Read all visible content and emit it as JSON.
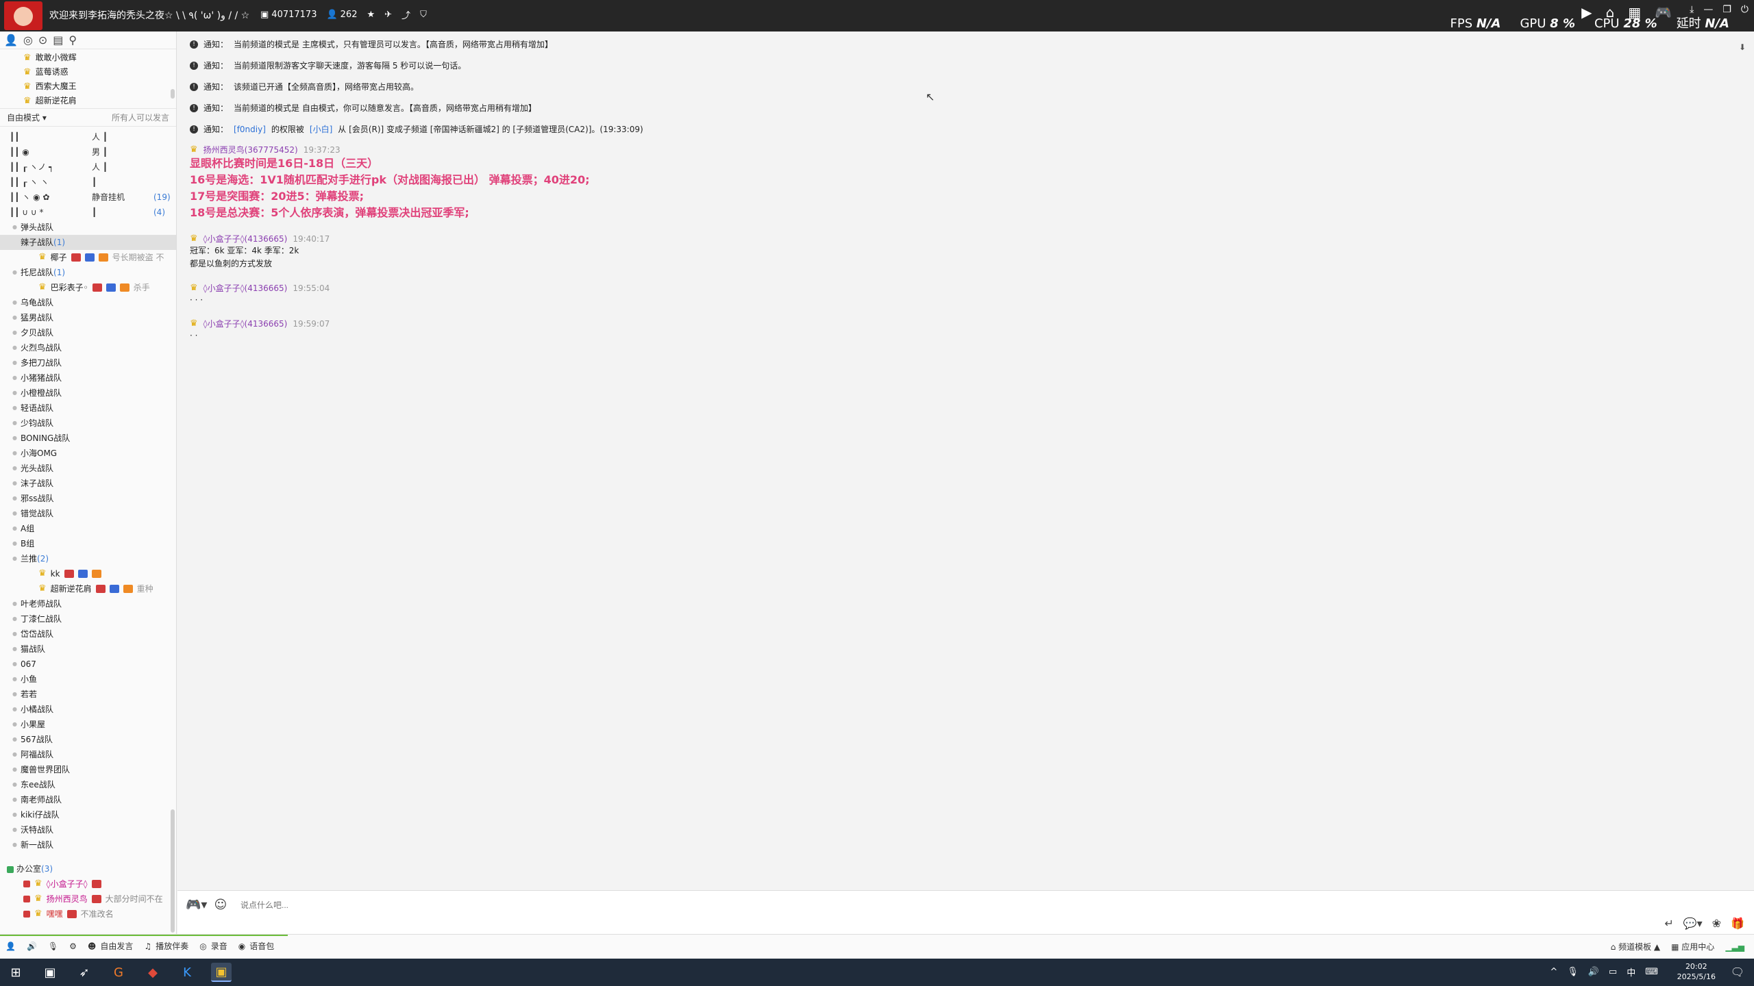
{
  "titlebar": {
    "title": "欢迎来到李拓海的秃头之夜☆ \\ \\ ٩( 'ω' )و / / ☆",
    "channel_id": "40717173",
    "online_count": "262",
    "fps_label": "FPS",
    "fps_value": "N/A",
    "gpu_label": "GPU",
    "gpu_value": "8 %",
    "cpu_label": "CPU",
    "cpu_value": "28 %",
    "latency_label": "延时",
    "latency_value": "N/A"
  },
  "sidebar": {
    "top_rows": [
      "敢敢小微辉",
      "蓝莓诱惑",
      "西索大魔王",
      "超新逆花肩"
    ],
    "mode_label": "自由模式",
    "mode_right": "所有人可以发言",
    "glyph_rows": [
      {
        "rune": "┃┃",
        "name": "人 ┃",
        "count": ""
      },
      {
        "rune": "┃┃    ◉",
        "name": "男 ┃",
        "count": ""
      },
      {
        "rune": "┃┃  ┎ ヽノ ┑",
        "name": "人 ┃",
        "count": ""
      },
      {
        "rune": "┃┃  ┎ ヽ   ヽ",
        "name": "┃",
        "count": ""
      },
      {
        "rune": "┃┃  ヽ  ◉  ✿",
        "name": "静音挂机",
        "count": "(19)"
      },
      {
        "rune": "┃┃  ∪ ∪   *",
        "name": "┃",
        "count": "(4)"
      }
    ],
    "channels": [
      {
        "name": "弹头战队",
        "count": ""
      },
      {
        "name": "辣子战队",
        "count": "(1)",
        "selected": true,
        "members": [
          {
            "name": "椰子",
            "status": "号长期被盗 不"
          }
        ]
      },
      {
        "name": "托尼战队",
        "count": "(1)",
        "members": [
          {
            "name": "巴彩表子◦",
            "status": "杀手"
          }
        ]
      },
      {
        "name": "乌龟战队",
        "count": ""
      },
      {
        "name": "猛男战队",
        "count": ""
      },
      {
        "name": "夕贝战队",
        "count": ""
      },
      {
        "name": "火烈鸟战队",
        "count": ""
      },
      {
        "name": "多把刀战队",
        "count": ""
      },
      {
        "name": "小猪猪战队",
        "count": ""
      },
      {
        "name": "小橙橙战队",
        "count": ""
      },
      {
        "name": "轻语战队",
        "count": ""
      },
      {
        "name": "少钧战队",
        "count": ""
      },
      {
        "name": "BONING战队",
        "count": ""
      },
      {
        "name": "小海OMG",
        "count": ""
      },
      {
        "name": "光头战队",
        "count": ""
      },
      {
        "name": "沫子战队",
        "count": ""
      },
      {
        "name": "邪ss战队",
        "count": ""
      },
      {
        "name": "错觉战队",
        "count": ""
      },
      {
        "name": "A组",
        "count": ""
      },
      {
        "name": "B组",
        "count": ""
      },
      {
        "name": "兰推",
        "count": "(2)",
        "members": [
          {
            "name": "kk",
            "status": ""
          },
          {
            "name": "超新逆花肩",
            "status": "重种"
          }
        ]
      },
      {
        "name": "叶老师战队",
        "count": ""
      },
      {
        "name": "丁漆仁战队",
        "count": ""
      },
      {
        "name": "岱岱战队",
        "count": ""
      },
      {
        "name": "猫战队",
        "count": ""
      },
      {
        "name": "067",
        "count": ""
      },
      {
        "name": "小鱼",
        "count": ""
      },
      {
        "name": "若若",
        "count": ""
      },
      {
        "name": "小橘战队",
        "count": ""
      },
      {
        "name": "小果屋",
        "count": ""
      },
      {
        "name": "567战队",
        "count": ""
      },
      {
        "name": "阿福战队",
        "count": ""
      },
      {
        "name": "魔兽世界团队",
        "count": ""
      },
      {
        "name": "东ee战队",
        "count": ""
      },
      {
        "name": "南老师战队",
        "count": ""
      },
      {
        "name": "kiki仔战队",
        "count": ""
      },
      {
        "name": "沃特战队",
        "count": ""
      },
      {
        "name": "新一战队",
        "count": ""
      }
    ],
    "office": {
      "name": "办公室",
      "count": "(3)",
      "members": [
        {
          "name": "◊小盒子子◊",
          "status": "",
          "style": "purple"
        },
        {
          "name": "扬州西灵鸟",
          "status": "大部分时间不在",
          "style": "purple"
        },
        {
          "name": "嘿嘿",
          "status": "不准改名",
          "style": "red"
        }
      ]
    }
  },
  "chat": {
    "notices": [
      {
        "prefix": "通知：",
        "text": "当前频道的模式是 主席模式，只有管理员可以发言。【高音质，网络带宽占用稍有增加】"
      },
      {
        "prefix": "通知：",
        "text": "当前频道限制游客文字聊天速度，游客每隔 5 秒可以说一句话。"
      },
      {
        "prefix": "通知：",
        "text": "该频道已开通【全频高音质】，网络带宽占用较高。"
      },
      {
        "prefix": "通知：",
        "text": "当前频道的模式是 自由模式，你可以随意发言。【高音质，网络带宽占用稍有增加】"
      },
      {
        "prefix": "通知：",
        "link1": "[f0ndiy]",
        "mid1": " 的权限被 ",
        "link2": "[小白]",
        "text": " 从 [会员(R)] 变成子频道 [帝国神话新疆城2] 的 [子频道管理员(CA2)]。(19:33:09)"
      }
    ],
    "messages": [
      {
        "sender": "扬州西灵鸟(367775452)",
        "time": "19:37:23",
        "big_lines": [
          "显眼杯比赛时间是16日-18日（三天）",
          "16号是海选：1V1随机匹配对手进行pk（对战图海报已出）   弹幕投票；40进20;",
          "17号是突围赛：20进5：弹幕投票;",
          "18号是总决赛：5个人依序表演，弹幕投票决出冠亚季军;"
        ]
      },
      {
        "sender": "◊小盒子子◊(4136665)",
        "time": "19:40:17",
        "lines": [
          "冠军：6k 亚军：4k 季军：2k",
          "都是以鱼刺的方式发放"
        ]
      },
      {
        "sender": "◊小盒子子◊(4136665)",
        "time": "19:55:04",
        "lines": [
          "· · ·"
        ]
      },
      {
        "sender": "◊小盒子子◊(4136665)",
        "time": "19:59:07",
        "lines": [
          "· ·"
        ]
      }
    ]
  },
  "input": {
    "placeholder": "说点什么吧..."
  },
  "bottombar": {
    "buttons": [
      "自由发言",
      "播放伴奏",
      "录音",
      "语音包"
    ],
    "right_items": [
      "频道模板 ▲",
      "应用中心"
    ]
  },
  "taskbar": {
    "time": "20:02",
    "date": "2025/5/16",
    "ime": "中"
  }
}
